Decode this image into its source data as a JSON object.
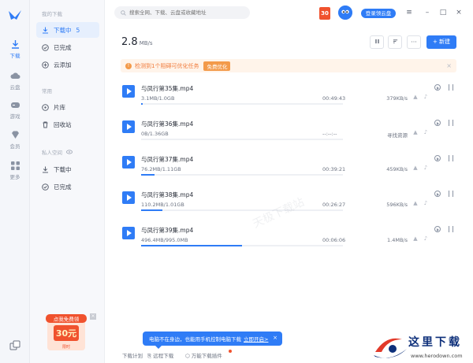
{
  "rail": {
    "items": [
      {
        "label": "下载",
        "icon": "download-icon",
        "active": true
      },
      {
        "label": "云盘",
        "icon": "cloud-icon"
      },
      {
        "label": "游戏",
        "icon": "gamepad-icon"
      },
      {
        "label": "会员",
        "icon": "diamond-icon"
      },
      {
        "label": "更多",
        "icon": "grid-icon"
      }
    ]
  },
  "sidebar": {
    "my_downloads_title": "我的下载",
    "items": [
      {
        "label": "下载中",
        "count": "5",
        "icon": "download-icon"
      },
      {
        "label": "已完成",
        "icon": "check-circle-icon"
      },
      {
        "label": "云添加",
        "icon": "cloud-add-icon"
      }
    ],
    "common_title": "常用",
    "common_items": [
      {
        "label": "片库",
        "icon": "film-icon"
      },
      {
        "label": "回收站",
        "icon": "trash-icon"
      }
    ],
    "private_title": "私人空间",
    "private_items": [
      {
        "label": "下载中",
        "icon": "download-icon"
      },
      {
        "label": "已完成",
        "icon": "check-circle-icon"
      }
    ],
    "promo": {
      "line1": "点我免费领",
      "amount": "30元",
      "line2": "限时"
    }
  },
  "header": {
    "search_placeholder": "搜索全网、下载、云盘或收藏地址",
    "badge": "30",
    "login_label": "登录领云盘"
  },
  "toolbar": {
    "speed_value": "2.8",
    "speed_unit": "MB/s",
    "new_label": "+ 新建"
  },
  "notice": {
    "text": "检测到1个阻碍可优化任务",
    "action": "免费优化"
  },
  "tasks": [
    {
      "name": "与凤行第35集.mp4",
      "size": "3.1MB/1.0GB",
      "time": "00:49:43",
      "rate": "379KB/s",
      "progress": 0.003
    },
    {
      "name": "与凤行第36集.mp4",
      "size": "0B/1.36GB",
      "time": "--:--:--",
      "rate": "寻找资源",
      "progress": 0
    },
    {
      "name": "与凤行第37集.mp4",
      "size": "76.2MB/1.11GB",
      "time": "00:39:21",
      "rate": "459KB/s",
      "progress": 0.067
    },
    {
      "name": "与凤行第38集.mp4",
      "size": "110.2MB/1.01GB",
      "time": "00:26:27",
      "rate": "596KB/s",
      "progress": 0.107
    },
    {
      "name": "与凤行第39集.mp4",
      "size": "496.4MB/995.0MB",
      "time": "00:06:06",
      "rate": "1.4MB/s",
      "progress": 0.499
    }
  ],
  "watermark": "天极下载站",
  "footer": {
    "plan": "下载计划",
    "remote": "远程下载",
    "plugin": "万能下载插件",
    "tooltip_text": "电脑不在身边，也能用手机控制电脑下载",
    "tooltip_link": "立即开启>"
  },
  "corner": {
    "title": "这里下载",
    "url": "www.herodown.com"
  },
  "colors": {
    "accent": "#2f7cf6",
    "warning": "#f39a4a",
    "badge": "#f0522e"
  }
}
